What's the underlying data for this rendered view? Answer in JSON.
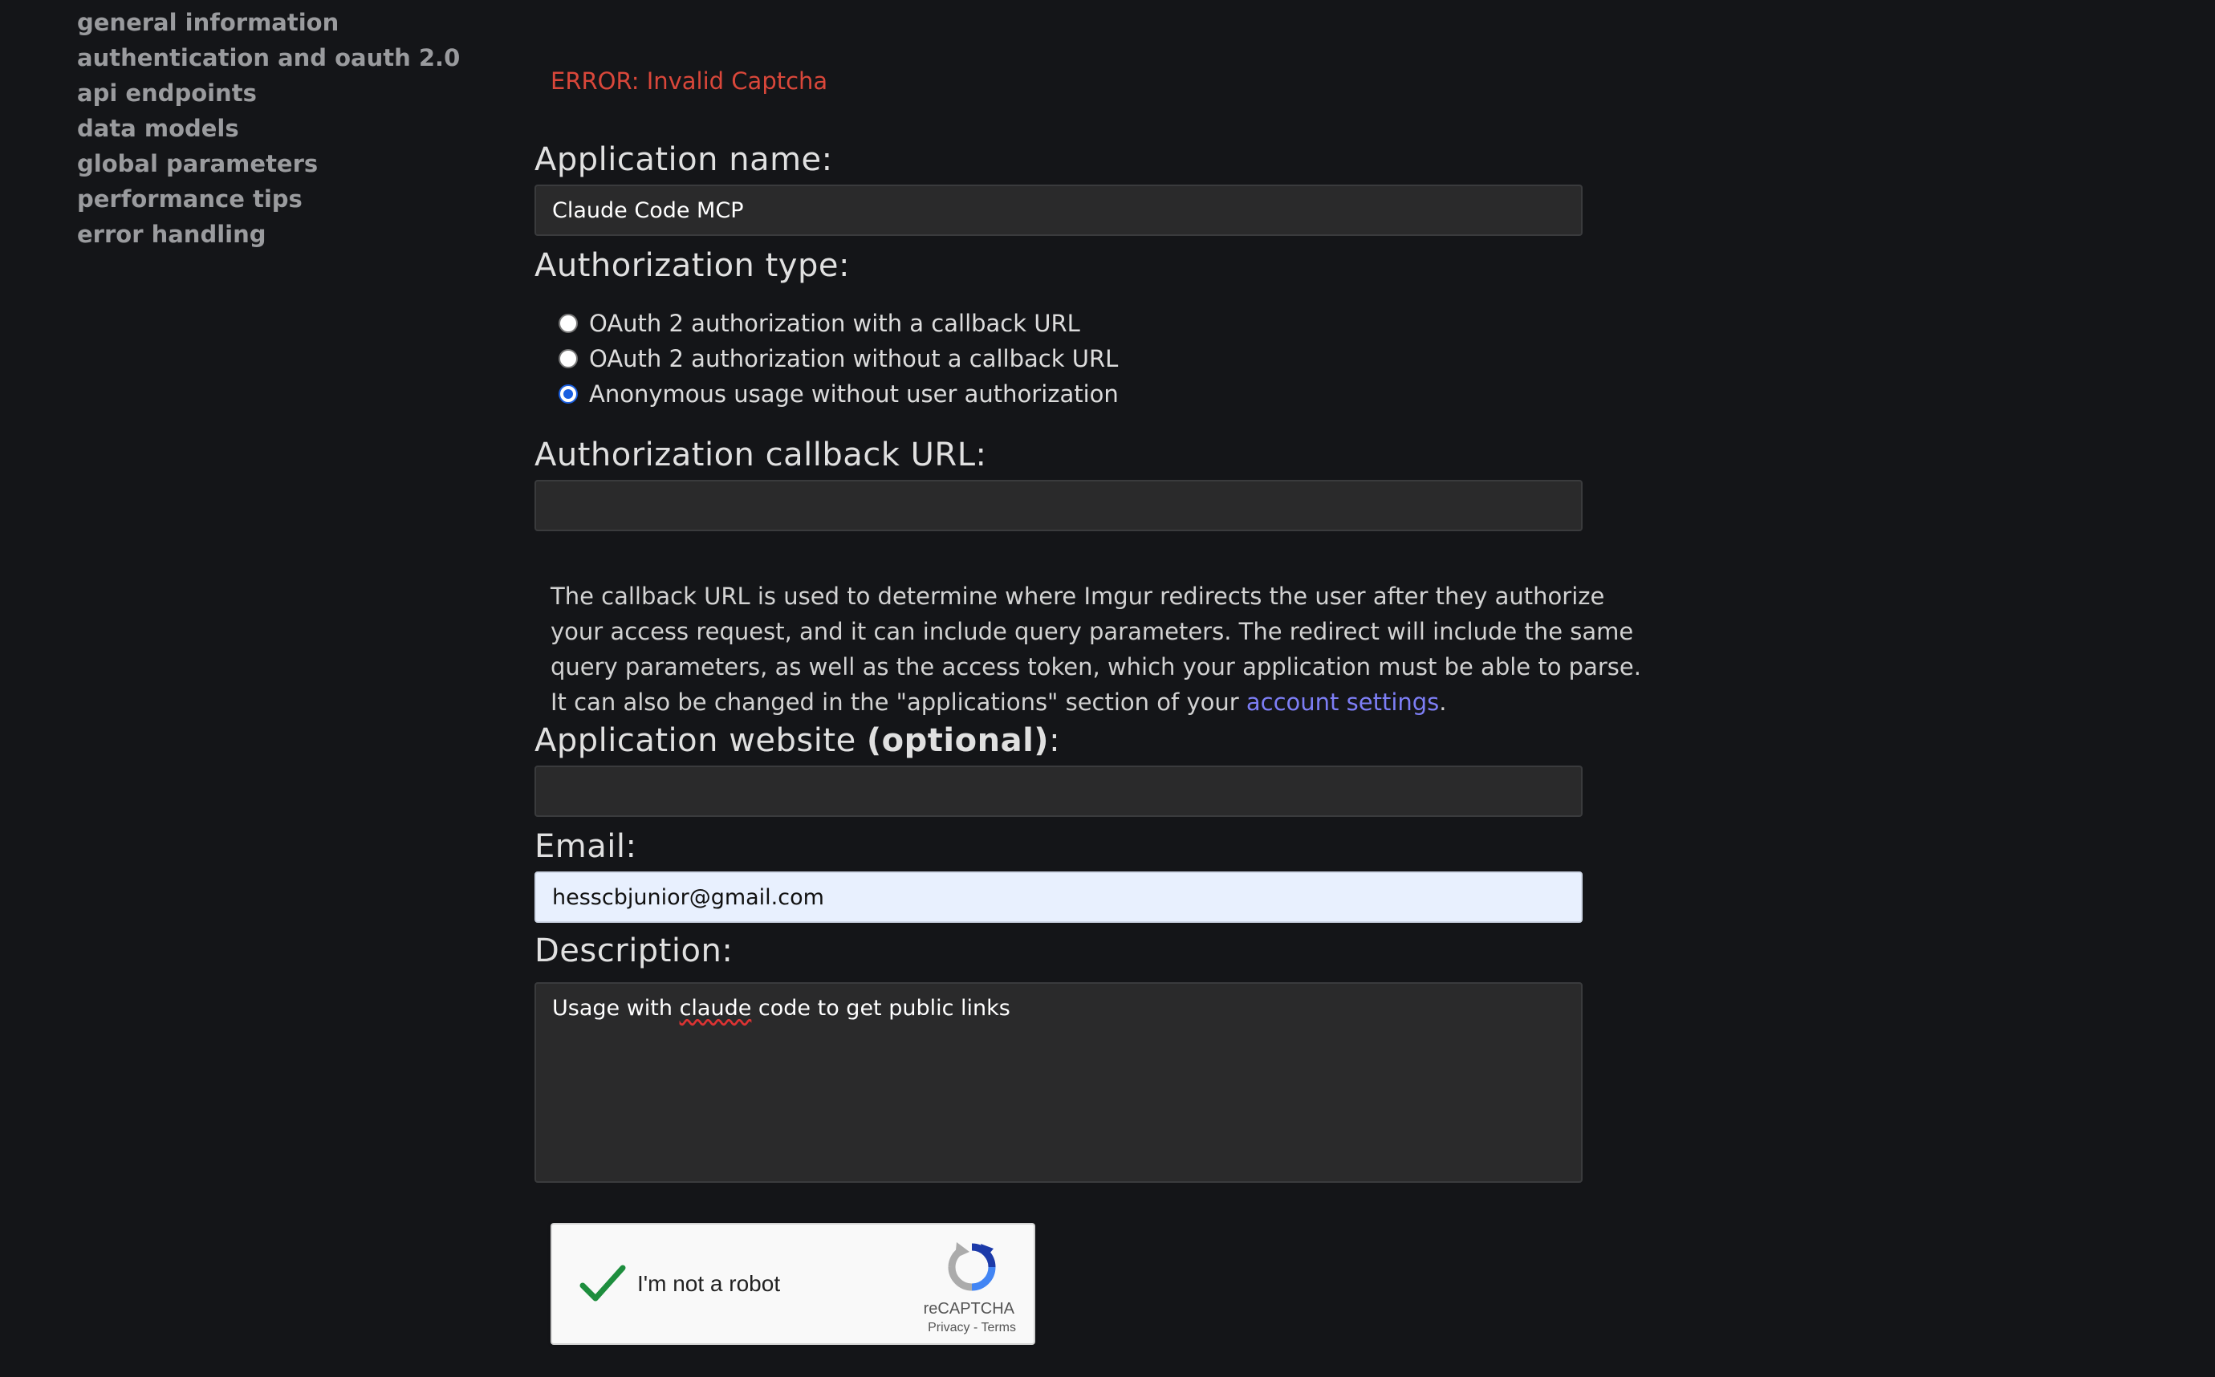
{
  "sidebar": {
    "items": [
      {
        "label": "general information"
      },
      {
        "label": "authentication and oauth 2.0"
      },
      {
        "label": "api endpoints"
      },
      {
        "label": "data models"
      },
      {
        "label": "global parameters"
      },
      {
        "label": "performance tips"
      },
      {
        "label": "error handling"
      }
    ]
  },
  "form": {
    "error_message": "ERROR: Invalid Captcha",
    "app_name_label": "Application name:",
    "app_name_value": "Claude Code MCP",
    "auth_type_label": "Authorization type:",
    "auth_options": [
      {
        "label": "OAuth 2 authorization with a callback URL",
        "checked": false
      },
      {
        "label": "OAuth 2 authorization without a callback URL",
        "checked": false
      },
      {
        "label": "Anonymous usage without user authorization",
        "checked": true
      }
    ],
    "callback_label": "Authorization callback URL:",
    "callback_value": "",
    "callback_help_text": "The callback URL is used to determine where Imgur redirects the user after they authorize your access request, and it can include query parameters. The redirect will include the same query parameters, as well as the access token, which your application must be able to parse. It can also be changed in the \"applications\" section of your ",
    "callback_help_link": "account settings",
    "callback_help_end": ".",
    "website_label": "Application website ",
    "website_label_optional": "(optional)",
    "website_label_colon": ":",
    "website_value": "",
    "email_label": "Email:",
    "email_value": "hesscbjunior@gmail.com",
    "description_label": "Description:",
    "description_before": "Usage with ",
    "description_misspelled": "claude",
    "description_after": " code to get public links"
  },
  "recaptcha": {
    "label": "I'm not a robot",
    "brand": "reCAPTCHA",
    "links": "Privacy - Terms",
    "checked": true
  },
  "colors": {
    "background": "#141518",
    "error": "#d9473a",
    "link": "#7d7ef5",
    "sidebar_link": "#9a9b9e"
  }
}
